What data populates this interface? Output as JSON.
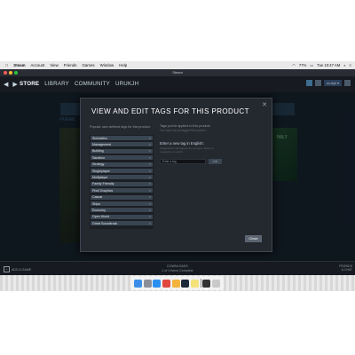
{
  "menubar": {
    "apple": "",
    "items": [
      "Steam",
      "Account",
      "View",
      "Friends",
      "Games",
      "Window",
      "Help"
    ],
    "battery": "77%",
    "clock": "Tue 10:47 AM"
  },
  "window": {
    "title": "Steam"
  },
  "nav": {
    "back": "◀",
    "forward": "▶",
    "links": [
      "STORE",
      "LIBRARY",
      "COMMUNITY",
      "URUKJH"
    ],
    "user": "urukjh ▾"
  },
  "store": {
    "planet": "Planet",
    "art_label": "NET"
  },
  "dialog": {
    "title": "VIEW AND EDIT TAGS FOR THIS PRODUCT",
    "close": "✕",
    "left_heading": "Popular user-defined tags for this product:",
    "tags": [
      "Simulation",
      "Management",
      "Building",
      "Sandbox",
      "Strategy",
      "Singleplayer",
      "Multiplayer",
      "Family Friendly",
      "Pixel Graphics",
      "Casual",
      "Ships",
      "Economy",
      "Open World",
      "Great Soundtrack"
    ],
    "tag_remove": "✕",
    "right_heading": "Tags you've applied to this product:",
    "right_sub": "You have not yet tagged this product",
    "enter_heading": "Enter a new tag in English:",
    "enter_sub": "Suggestions will appear as you type. Select a suggestion to add it.",
    "input_placeholder": "Enter a tag",
    "add_label": "Add",
    "close_label": "Close"
  },
  "bottombar": {
    "add_game": "ADD A GAME",
    "downloads": "DOWNLOADS",
    "downloads_sub": "1 of 1 Items Complete",
    "friends": "FRIENDS",
    "chat": "& CHAT"
  },
  "colors": {
    "steam_bg": "#1b2838",
    "accent": "#66c0f4",
    "tag_bg": "#3a4552",
    "button": "#5b6470"
  },
  "dock_icons": [
    "finder-icon",
    "launchpad-icon",
    "safari-icon",
    "chrome-icon",
    "photos-icon",
    "steam-icon",
    "notes-icon",
    "terminal-icon",
    "trash-icon"
  ]
}
